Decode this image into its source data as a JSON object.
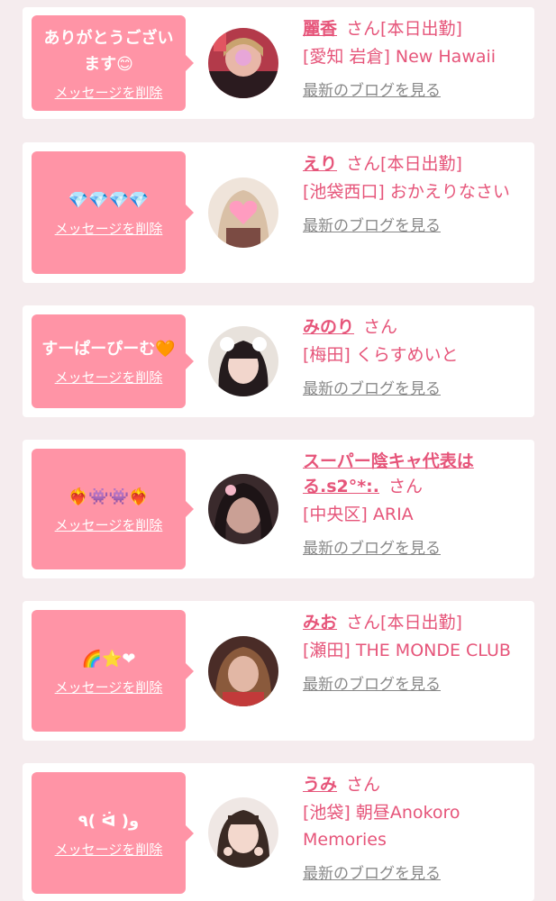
{
  "accent_color": "#e6557a",
  "bubble_color": "#ff94a6",
  "delete_label": "メッセージを削除",
  "blog_label": "最新のブログを見る",
  "san_label": "さん",
  "cards": [
    {
      "message": "ありがとうございます😊",
      "name": "麗香",
      "status": "[本日出勤]",
      "shop": "[愛知 岩倉] New Hawaii"
    },
    {
      "message": "💎💎💎💎",
      "name": "えり",
      "status": "[本日出勤]",
      "shop": "[池袋西口] おかえりなさい"
    },
    {
      "message": "すーぱーぴーむ🧡",
      "name": "みのり",
      "status": "",
      "shop": "[梅田] くらすめいと"
    },
    {
      "message": "❤️‍🔥👾👾❤️‍🔥",
      "name": "スーパー陰キャ代表は る.s2°*:.",
      "status": "",
      "shop": "[中央区] ARIA"
    },
    {
      "message": "🌈⭐❤",
      "name": "みお",
      "status": "[本日出勤]",
      "shop": "[瀬田] THE MONDE CLUB"
    },
    {
      "message": "٩( ᐛ )و",
      "name": "うみ",
      "status": "",
      "shop": "[池袋] 朝昼Anokoro Memories"
    }
  ]
}
